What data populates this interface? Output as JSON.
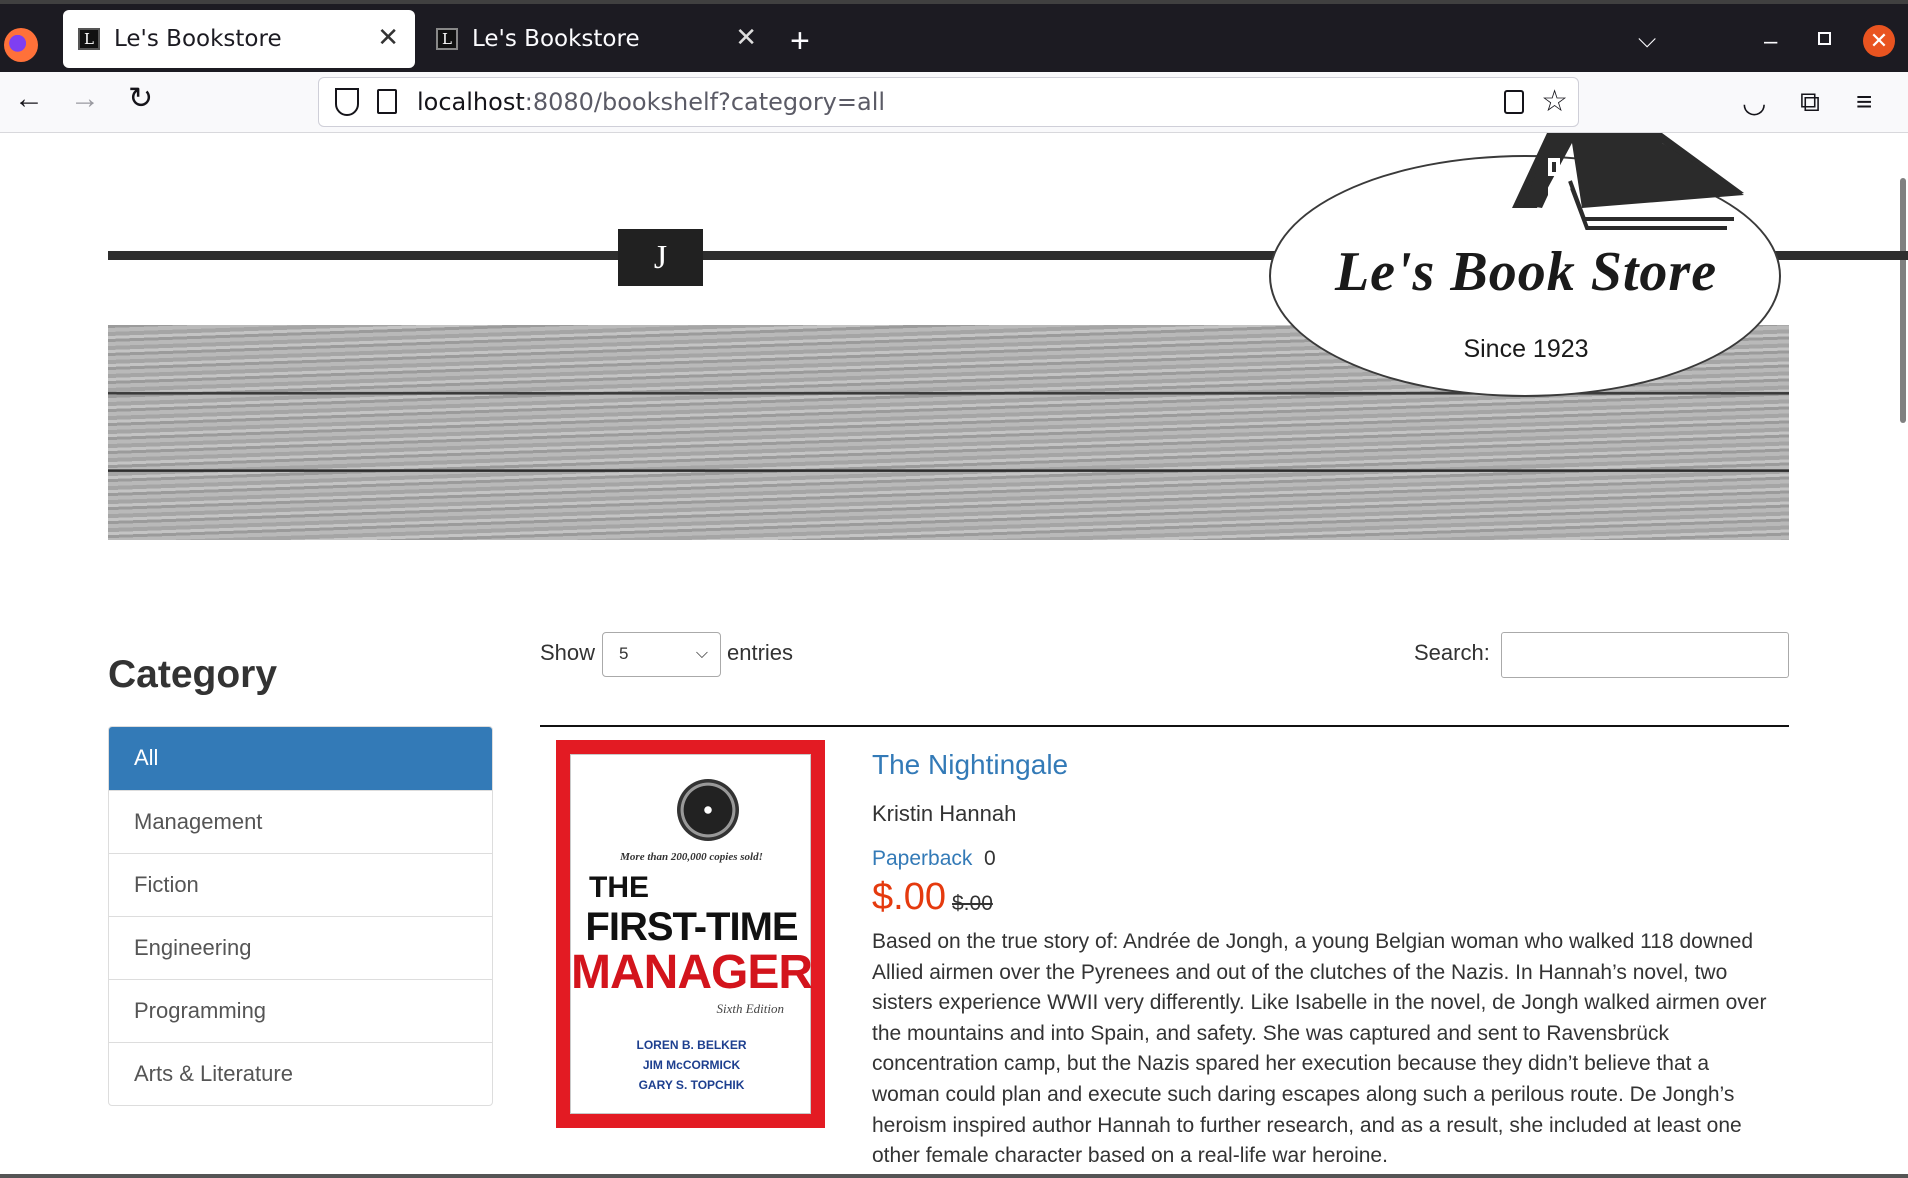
{
  "browser": {
    "tabs": [
      {
        "title": "Le's Bookstore",
        "favicon": "L",
        "close": "✕"
      },
      {
        "title": "Le's Bookstore",
        "favicon": "L",
        "close": "✕"
      }
    ],
    "new_tab": "+",
    "tab_list": "⌵",
    "url_host": "localhost",
    "url_path": ":8080/bookshelf?category=all"
  },
  "header": {
    "j_label": "J",
    "logo_title": "Le's Book Store",
    "logo_since": "Since 1923"
  },
  "sidebar": {
    "title": "Category",
    "items": [
      {
        "label": "All"
      },
      {
        "label": "Management"
      },
      {
        "label": "Fiction"
      },
      {
        "label": "Engineering"
      },
      {
        "label": "Programming"
      },
      {
        "label": "Arts & Literature"
      }
    ]
  },
  "table": {
    "show_label": "Show",
    "page_size": "5",
    "entries_label": "entries",
    "search_label": "Search:",
    "search_value": ""
  },
  "book": {
    "cover": {
      "tagline": "More than 200,000 copies sold!",
      "the": "THE",
      "first_time": "FIRST-TIME",
      "manager": "MANAGER",
      "edition": "Sixth Edition",
      "authors": [
        "LOREN B. BELKER",
        "JIM McCORMICK",
        "GARY S. TOPCHIK"
      ]
    },
    "title": "The Nightingale",
    "author": "Kristin Hannah",
    "format": "Paperback",
    "stock": "0",
    "price": "$.00",
    "old_price": "$.00",
    "description": "Based on the true story of: Andrée de Jongh, a young Belgian woman who walked 118 downed Allied airmen over the Pyrenees and out of the clutches of the Nazis. In Hannah’s novel, two sisters experience WWII very differently. Like Isabelle in the novel, de Jongh walked airmen over the mountains and into Spain, and safety. She was captured and sent to Ravensbrück concentration camp, but the Nazis spared her execution because they didn’t believe that a woman could plan and execute such daring escapes along such a perilous route. De Jongh’s heroism inspired author Hannah to further research, and as a result, she included at least one other female character based on a real-life war heroine."
  },
  "colors": {
    "accent": "#337ab7",
    "price": "#e53a0e",
    "cover_red": "#e31b23"
  }
}
